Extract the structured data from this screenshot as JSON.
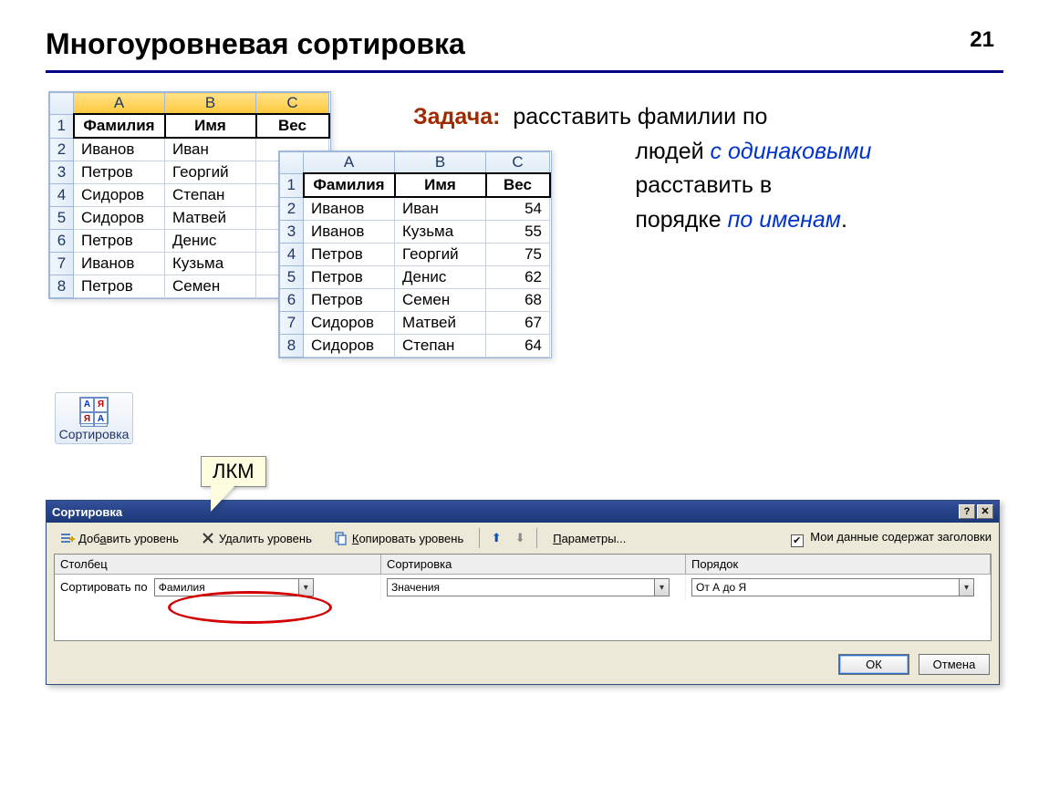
{
  "page": {
    "title": "Многоуровневая сортировка",
    "number": "21"
  },
  "task": {
    "label": "Задача:",
    "line1a": "расставить фамилии по",
    "line2a": "людей ",
    "line2em": "с одинаковыми",
    "line3a": "расставить в",
    "line4a": "порядке ",
    "line4em": "по именам",
    "dot": "."
  },
  "sortButton": {
    "label": "Сортировка"
  },
  "callout": {
    "text": "ЛКМ"
  },
  "grid1": {
    "cols": [
      "A",
      "B",
      "C"
    ],
    "header": [
      "Фамилия",
      "Имя",
      "Вес"
    ],
    "rows": [
      [
        "Иванов",
        "Иван",
        ""
      ],
      [
        "Петров",
        "Георгий",
        ""
      ],
      [
        "Сидоров",
        "Степан",
        ""
      ],
      [
        "Сидоров",
        "Матвей",
        ""
      ],
      [
        "Петров",
        "Денис",
        ""
      ],
      [
        "Иванов",
        "Кузьма",
        ""
      ],
      [
        "Петров",
        "Семен",
        ""
      ]
    ]
  },
  "grid2": {
    "cols": [
      "A",
      "B",
      "C"
    ],
    "header": [
      "Фамилия",
      "Имя",
      "Вес"
    ],
    "rows": [
      [
        "Иванов",
        "Иван",
        "54"
      ],
      [
        "Иванов",
        "Кузьма",
        "55"
      ],
      [
        "Петров",
        "Георгий",
        "75"
      ],
      [
        "Петров",
        "Денис",
        "62"
      ],
      [
        "Петров",
        "Семен",
        "68"
      ],
      [
        "Сидоров",
        "Матвей",
        "67"
      ],
      [
        "Сидоров",
        "Степан",
        "64"
      ]
    ]
  },
  "dialog": {
    "title": "Сортировка",
    "addLevel": "Добавить уровень",
    "delLevel": "Удалить уровень",
    "copyLevel": "Копировать уровень",
    "params": "Параметры...",
    "hasHeaders": "Мои данные содержат заголовки",
    "head": {
      "col": "Столбец",
      "sort": "Сортировка",
      "order": "Порядок"
    },
    "row1": {
      "label": "Сортировать по",
      "field": "Фамилия",
      "sort": "Значения",
      "order": "От А до Я"
    },
    "ok": "ОК",
    "cancel": "Отмена"
  }
}
